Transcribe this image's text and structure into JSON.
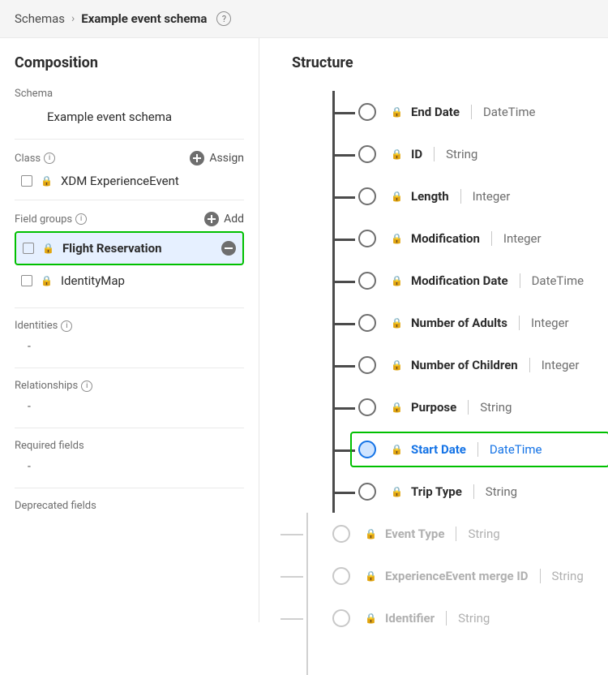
{
  "breadcrumb": {
    "root": "Schemas",
    "current": "Example event schema"
  },
  "composition": {
    "title": "Composition",
    "schema_label": "Schema",
    "schema_value": "Example event schema",
    "class_label": "Class",
    "assign_label": "Assign",
    "class_items": [
      {
        "label": "XDM ExperienceEvent"
      }
    ],
    "field_groups_label": "Field groups",
    "add_label": "Add",
    "field_group_items": [
      {
        "label": "Flight Reservation",
        "highlight": true
      },
      {
        "label": "IdentityMap",
        "highlight": false
      }
    ],
    "identities_label": "Identities",
    "identities_value": "-",
    "relationships_label": "Relationships",
    "relationships_value": "-",
    "required_label": "Required fields",
    "required_value": "-",
    "deprecated_label": "Deprecated fields"
  },
  "structure": {
    "title": "Structure",
    "nodes": [
      {
        "name": "End Date",
        "type": "DateTime"
      },
      {
        "name": "ID",
        "type": "String"
      },
      {
        "name": "Length",
        "type": "Integer"
      },
      {
        "name": "Modification",
        "type": "Integer"
      },
      {
        "name": "Modification Date",
        "type": "DateTime"
      },
      {
        "name": "Number of Adults",
        "type": "Integer"
      },
      {
        "name": "Number of Children",
        "type": "Integer"
      },
      {
        "name": "Purpose",
        "type": "String"
      },
      {
        "name": "Start Date",
        "type": "DateTime",
        "selected": true
      },
      {
        "name": "Trip Type",
        "type": "String"
      }
    ],
    "dim_nodes": [
      {
        "name": "Event Type",
        "type": "String"
      },
      {
        "name": "ExperienceEvent merge ID",
        "type": "String"
      },
      {
        "name": "Identifier",
        "type": "String"
      }
    ]
  }
}
